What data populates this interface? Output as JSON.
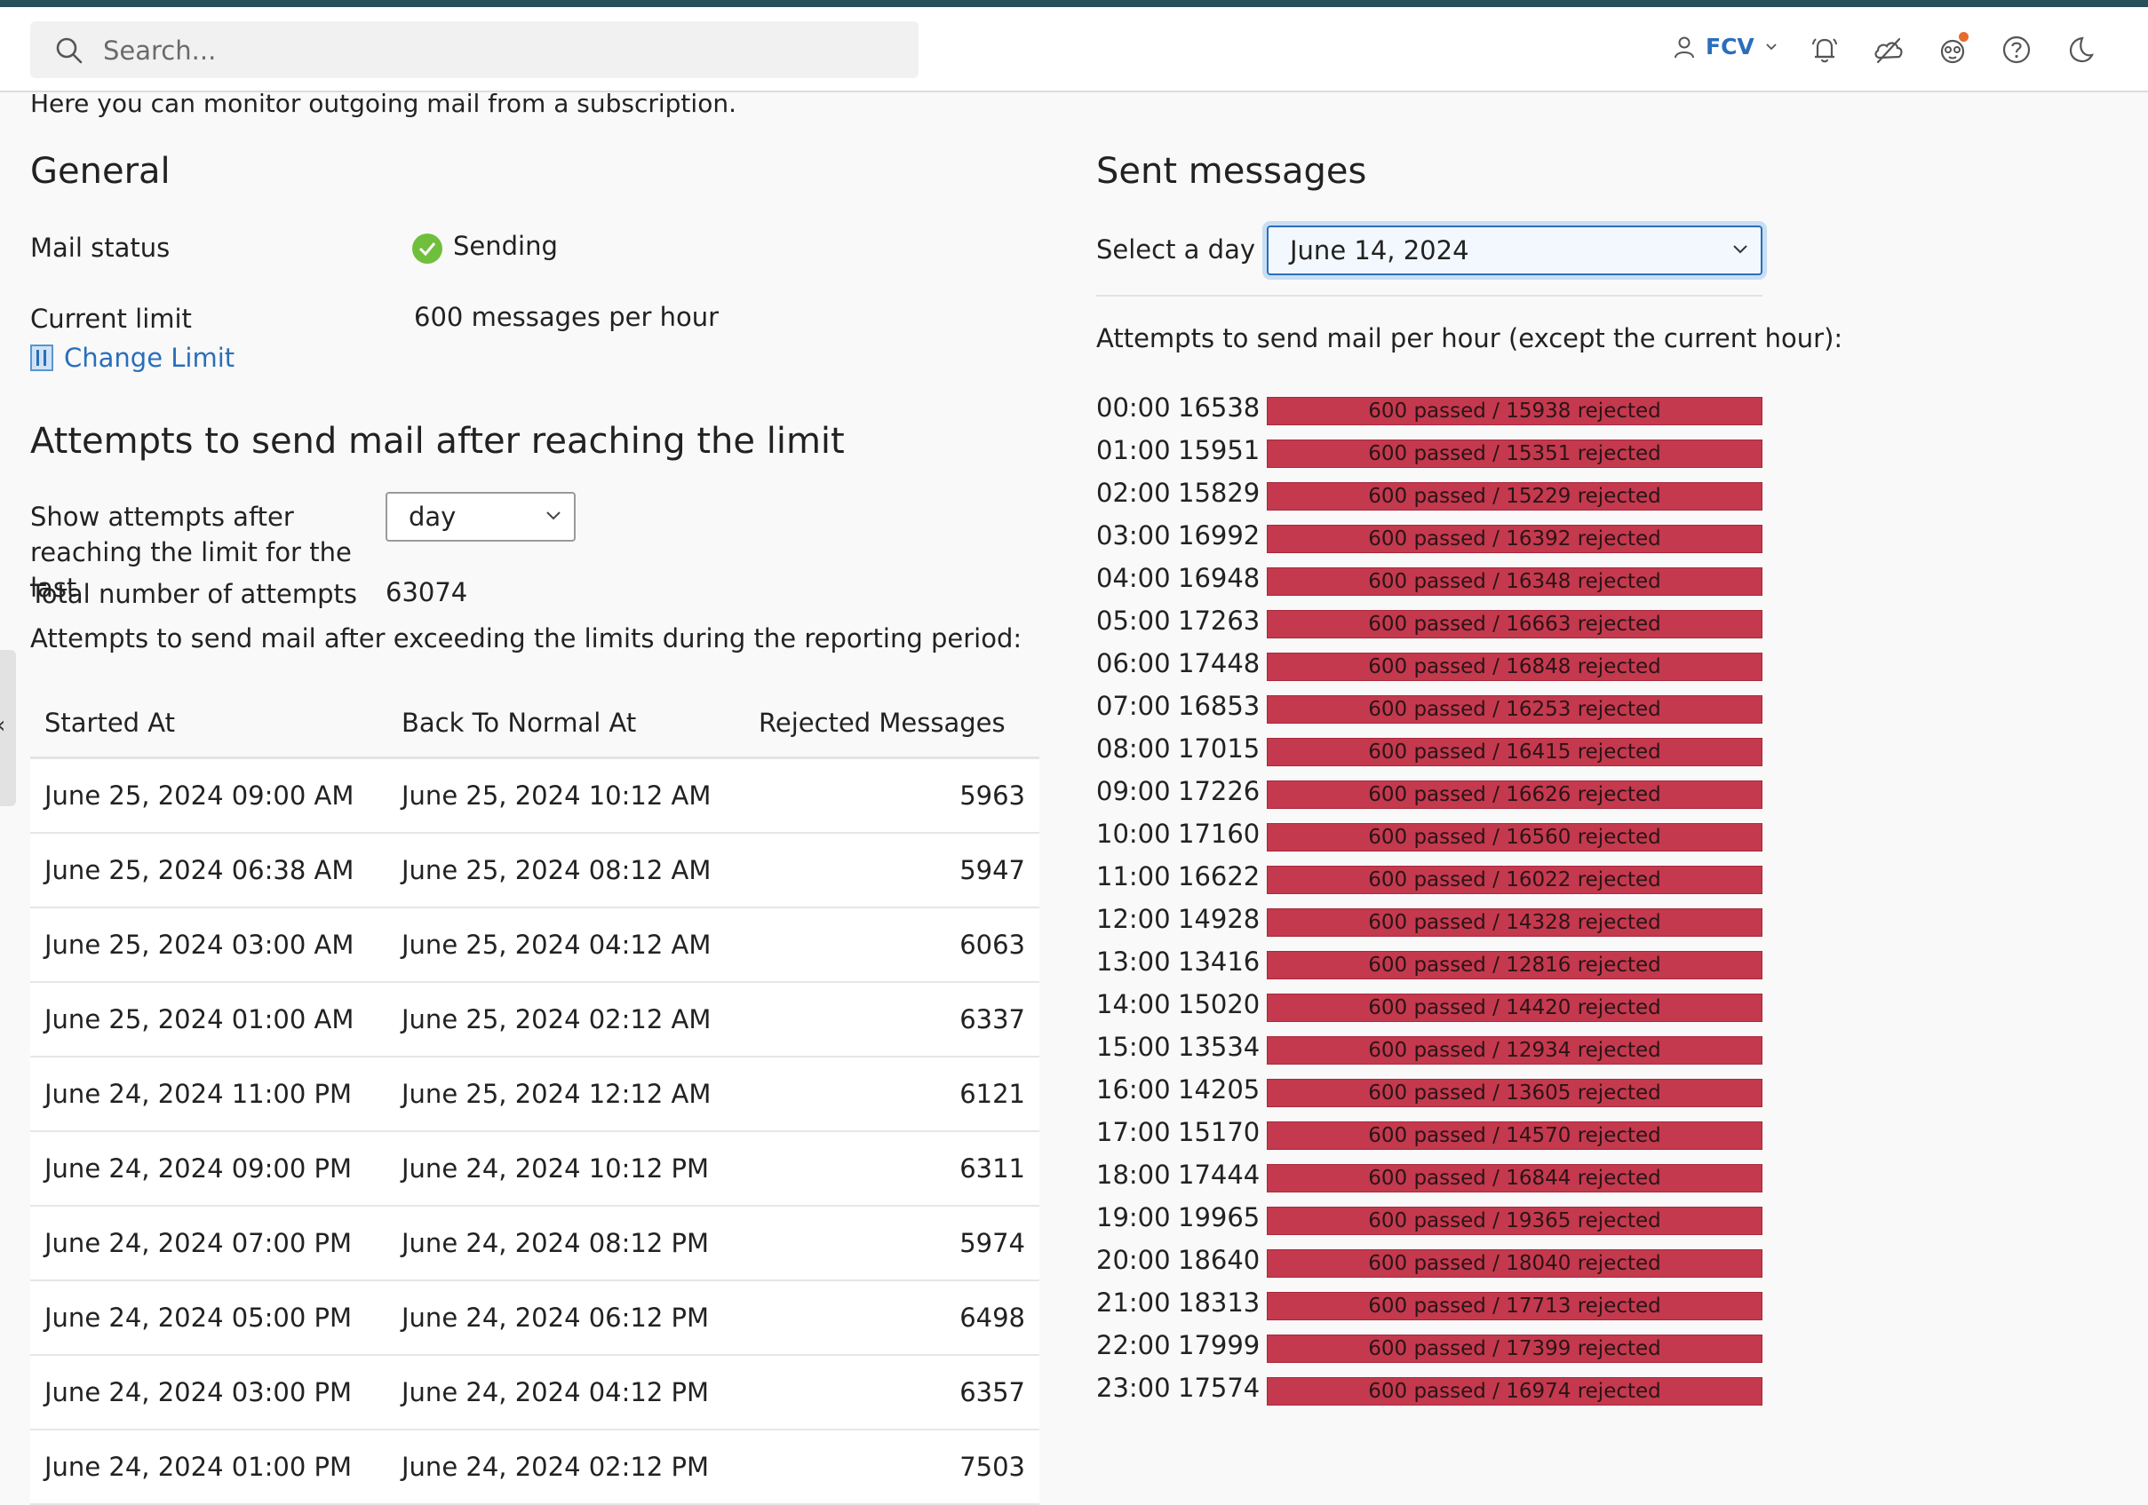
{
  "search": {
    "placeholder": "Search..."
  },
  "header": {
    "user": "FCV"
  },
  "intro": "Here you can monitor outgoing mail from a subscription.",
  "general": {
    "title": "General",
    "mail_status_label": "Mail status",
    "mail_status_value": "Sending",
    "current_limit_label": "Current limit",
    "current_limit_value": "600 messages per hour",
    "change_limit": "Change Limit"
  },
  "attempts": {
    "title": "Attempts to send mail after reaching the limit",
    "show_label": "Show attempts after reaching the limit for the last",
    "period": "day",
    "total_label": "Total number of attempts",
    "total_value": "63074",
    "exceeding_label": "Attempts to send mail after exceeding the limits during the reporting period:",
    "columns": [
      "Started At",
      "Back To Normal At",
      "Rejected Messages"
    ],
    "rows": [
      [
        "June 25, 2024 09:00 AM",
        "June 25, 2024 10:12 AM",
        "5963"
      ],
      [
        "June 25, 2024 06:38 AM",
        "June 25, 2024 08:12 AM",
        "5947"
      ],
      [
        "June 25, 2024 03:00 AM",
        "June 25, 2024 04:12 AM",
        "6063"
      ],
      [
        "June 25, 2024 01:00 AM",
        "June 25, 2024 02:12 AM",
        "6337"
      ],
      [
        "June 24, 2024 11:00 PM",
        "June 25, 2024 12:12 AM",
        "6121"
      ],
      [
        "June 24, 2024 09:00 PM",
        "June 24, 2024 10:12 PM",
        "6311"
      ],
      [
        "June 24, 2024 07:00 PM",
        "June 24, 2024 08:12 PM",
        "5974"
      ],
      [
        "June 24, 2024 05:00 PM",
        "June 24, 2024 06:12 PM",
        "6498"
      ],
      [
        "June 24, 2024 03:00 PM",
        "June 24, 2024 04:12 PM",
        "6357"
      ],
      [
        "June 24, 2024 01:00 PM",
        "June 24, 2024 02:12 PM",
        "7503"
      ]
    ]
  },
  "sent": {
    "title": "Sent messages",
    "select_label": "Select a day :",
    "selected_day": "June 14, 2024",
    "hour_title": "Attempts to send mail per hour (except the current hour):",
    "hours": [
      {
        "time": "00:00",
        "total": "16538",
        "bar": "600 passed / 15938 rejected"
      },
      {
        "time": "01:00",
        "total": "15951",
        "bar": "600 passed / 15351 rejected"
      },
      {
        "time": "02:00",
        "total": "15829",
        "bar": "600 passed / 15229 rejected"
      },
      {
        "time": "03:00",
        "total": "16992",
        "bar": "600 passed / 16392 rejected"
      },
      {
        "time": "04:00",
        "total": "16948",
        "bar": "600 passed / 16348 rejected"
      },
      {
        "time": "05:00",
        "total": "17263",
        "bar": "600 passed / 16663 rejected"
      },
      {
        "time": "06:00",
        "total": "17448",
        "bar": "600 passed / 16848 rejected"
      },
      {
        "time": "07:00",
        "total": "16853",
        "bar": "600 passed / 16253 rejected"
      },
      {
        "time": "08:00",
        "total": "17015",
        "bar": "600 passed / 16415 rejected"
      },
      {
        "time": "09:00",
        "total": "17226",
        "bar": "600 passed / 16626 rejected"
      },
      {
        "time": "10:00",
        "total": "17160",
        "bar": "600 passed / 16560 rejected"
      },
      {
        "time": "11:00",
        "total": "16622",
        "bar": "600 passed / 16022 rejected"
      },
      {
        "time": "12:00",
        "total": "14928",
        "bar": "600 passed / 14328 rejected"
      },
      {
        "time": "13:00",
        "total": "13416",
        "bar": "600 passed / 12816 rejected"
      },
      {
        "time": "14:00",
        "total": "15020",
        "bar": "600 passed / 14420 rejected"
      },
      {
        "time": "15:00",
        "total": "13534",
        "bar": "600 passed / 12934 rejected"
      },
      {
        "time": "16:00",
        "total": "14205",
        "bar": "600 passed / 13605 rejected"
      },
      {
        "time": "17:00",
        "total": "15170",
        "bar": "600 passed / 14570 rejected"
      },
      {
        "time": "18:00",
        "total": "17444",
        "bar": "600 passed / 16844 rejected"
      },
      {
        "time": "19:00",
        "total": "19965",
        "bar": "600 passed / 19365 rejected"
      },
      {
        "time": "20:00",
        "total": "18640",
        "bar": "600 passed / 18040 rejected"
      },
      {
        "time": "21:00",
        "total": "18313",
        "bar": "600 passed / 17713 rejected"
      },
      {
        "time": "22:00",
        "total": "17999",
        "bar": "600 passed / 17399 rejected"
      },
      {
        "time": "23:00",
        "total": "17574",
        "bar": "600 passed / 16974 rejected"
      }
    ]
  },
  "colors": {
    "accent": "#2a6ebb",
    "bar": "#c4394d",
    "status_ok": "#6fbf3d",
    "top_stripe": "#28505a"
  },
  "icons": [
    "search-icon",
    "user-icon",
    "chevron-down-icon",
    "notifications-icon",
    "cloud-off-icon",
    "extensions-icon",
    "help-icon",
    "dark-mode-icon",
    "check-circle-icon",
    "change-limit-icon",
    "collapse-sidebar-icon"
  ]
}
